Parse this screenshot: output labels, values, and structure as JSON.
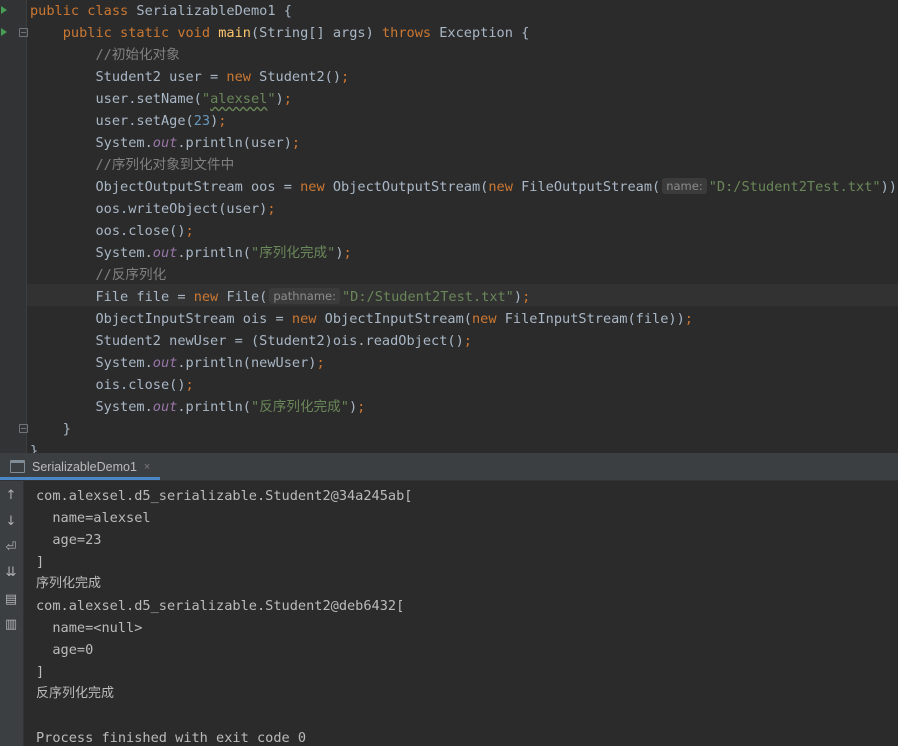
{
  "editor": {
    "lines": [
      [
        [
          "kw",
          "public class "
        ],
        [
          "p",
          "SerializableDemo1 {"
        ]
      ],
      [
        [
          "kw",
          "    public static void "
        ],
        [
          "fn",
          "main"
        ],
        [
          "p",
          "(String[] args) "
        ],
        [
          "kw",
          "throws "
        ],
        [
          "p",
          "Exception {"
        ]
      ],
      [
        [
          "cm",
          "        //"
        ],
        [
          "cmcjk",
          "初始化对象"
        ]
      ],
      [
        [
          "p",
          "        Student2 user = "
        ],
        [
          "kw",
          "new "
        ],
        [
          "p",
          "Student2()"
        ],
        [
          "kw",
          ";"
        ]
      ],
      [
        [
          "p",
          "        user.setName("
        ],
        [
          "st",
          "\""
        ],
        [
          "stsq",
          "alexsel"
        ],
        [
          "st",
          "\""
        ],
        [
          "p",
          ")"
        ],
        [
          "kw",
          ";"
        ]
      ],
      [
        [
          "p",
          "        user.setAge("
        ],
        [
          "num",
          "23"
        ],
        [
          "p",
          ")"
        ],
        [
          "kw",
          ";"
        ]
      ],
      [
        [
          "p",
          "        System."
        ],
        [
          "fld",
          "out"
        ],
        [
          "p",
          ".println(user)"
        ],
        [
          "kw",
          ";"
        ]
      ],
      [
        [
          "cm",
          "        //"
        ],
        [
          "cmcjk",
          "序列化对象到文件中"
        ]
      ],
      [
        [
          "p",
          "        ObjectOutputStream oos = "
        ],
        [
          "kw",
          "new "
        ],
        [
          "p",
          "ObjectOutputStream("
        ],
        [
          "kw",
          "new "
        ],
        [
          "p",
          "FileOutputStream("
        ],
        [
          "hint",
          "name:"
        ],
        [
          "st",
          "\"D:/Student2Test.txt\""
        ],
        [
          "p",
          "))"
        ],
        [
          "kw",
          ";"
        ]
      ],
      [
        [
          "p",
          "        oos.writeObject(user)"
        ],
        [
          "kw",
          ";"
        ]
      ],
      [
        [
          "p",
          "        oos.close()"
        ],
        [
          "kw",
          ";"
        ]
      ],
      [
        [
          "p",
          "        System."
        ],
        [
          "fld",
          "out"
        ],
        [
          "p",
          ".println("
        ],
        [
          "st",
          "\""
        ],
        [
          "stcjk",
          "序列化完成"
        ],
        [
          "st",
          "\""
        ],
        [
          "p",
          ")"
        ],
        [
          "kw",
          ";"
        ]
      ],
      [
        [
          "cm",
          "        //"
        ],
        [
          "cmcjk",
          "反序列化"
        ]
      ],
      [
        [
          "p",
          "        File file = "
        ],
        [
          "kw",
          "new "
        ],
        [
          "p",
          "File("
        ],
        [
          "hint",
          "pathname:"
        ],
        [
          "st",
          "\"D:/Student2Test.txt\""
        ],
        [
          "p",
          ")"
        ],
        [
          "kw",
          ";"
        ]
      ],
      [
        [
          "p",
          "        ObjectInputStream ois = "
        ],
        [
          "kw",
          "new "
        ],
        [
          "p",
          "ObjectInputStream("
        ],
        [
          "kw",
          "new "
        ],
        [
          "p",
          "FileInputStream(file))"
        ],
        [
          "kw",
          ";"
        ]
      ],
      [
        [
          "p",
          "        Student2 newUser = (Student2)ois.readObject()"
        ],
        [
          "kw",
          ";"
        ]
      ],
      [
        [
          "p",
          "        System."
        ],
        [
          "fld",
          "out"
        ],
        [
          "p",
          ".println(newUser)"
        ],
        [
          "kw",
          ";"
        ]
      ],
      [
        [
          "p",
          "        ois.close()"
        ],
        [
          "kw",
          ";"
        ]
      ],
      [
        [
          "p",
          "        System."
        ],
        [
          "fld",
          "out"
        ],
        [
          "p",
          ".println("
        ],
        [
          "st",
          "\""
        ],
        [
          "stcjk",
          "反序列化完成"
        ],
        [
          "st",
          "\""
        ],
        [
          "p",
          ")"
        ],
        [
          "kw",
          ";"
        ]
      ],
      [
        [
          "p",
          "    }"
        ]
      ],
      [
        [
          "p",
          "}"
        ]
      ]
    ]
  },
  "run_panel": {
    "tab_label": "SerializableDemo1",
    "tab_close": "×",
    "toolbar_icons": [
      "up-arrow-icon",
      "down-arrow-icon",
      "soft-wrap-icon",
      "scroll-to-end-icon",
      "print-icon",
      "trash-icon"
    ],
    "output": [
      {
        "text": "com.alexsel.d5_serializable.Student2@34a245ab[",
        "cjk": false
      },
      {
        "text": "  name=alexsel",
        "cjk": false
      },
      {
        "text": "  age=23",
        "cjk": false
      },
      {
        "text": "]",
        "cjk": false
      },
      {
        "text": "序列化完成",
        "cjk": true
      },
      {
        "text": "com.alexsel.d5_serializable.Student2@deb6432[",
        "cjk": false
      },
      {
        "text": "  name=<null>",
        "cjk": false
      },
      {
        "text": "  age=0",
        "cjk": false
      },
      {
        "text": "]",
        "cjk": false
      },
      {
        "text": "反序列化完成",
        "cjk": true
      },
      {
        "text": "",
        "cjk": false
      },
      {
        "text": "Process finished with exit code 0",
        "cjk": false
      }
    ]
  }
}
